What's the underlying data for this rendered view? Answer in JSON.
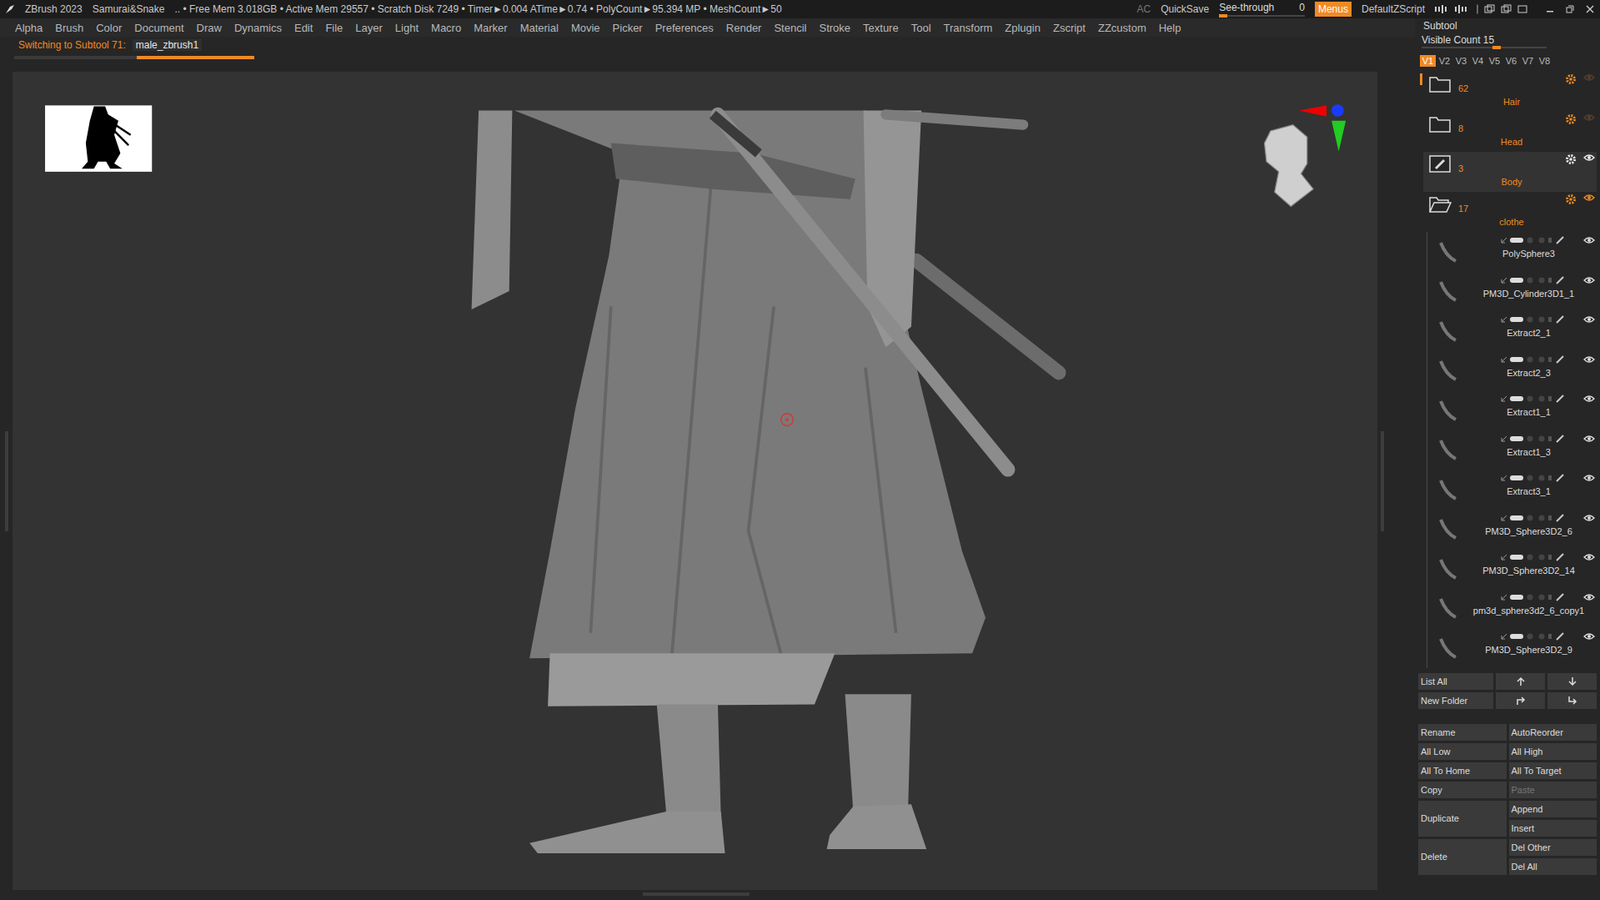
{
  "title_bar": {
    "app": "ZBrush 2023",
    "document": "Samurai&Snake",
    "stats": ".. • Free Mem 3.018GB • Active Mem 29557 • Scratch Disk 7249 • Timer►0.004 ATime►0.74 • PolyCount►95.394 MP • MeshCount►50",
    "ac": "AC",
    "quicksave": "QuickSave",
    "see_through": {
      "label": "See-through",
      "value": "0",
      "level": 0
    },
    "menus": {
      "label": "Menus",
      "selected": true
    },
    "script": "DefaultZScript"
  },
  "menu_bar": [
    "Alpha",
    "Brush",
    "Color",
    "Document",
    "Draw",
    "Dynamics",
    "Edit",
    "File",
    "Layer",
    "Light",
    "Macro",
    "Marker",
    "Material",
    "Movie",
    "Picker",
    "Preferences",
    "Render",
    "Stencil",
    "Stroke",
    "Texture",
    "Tool",
    "Transform",
    "Zplugin",
    "Zscript",
    "ZZcustom",
    "Help"
  ],
  "notice": {
    "label": "Switching to Subtool 71:",
    "subtool": "male_zbrush1",
    "level": 0.49
  },
  "subtool": {
    "title": "Subtool",
    "visible_count": {
      "label": "Visible Count 15",
      "level": 0.6
    },
    "views": [
      {
        "label": "V1",
        "selected": true
      },
      {
        "label": "V2",
        "selected": false
      },
      {
        "label": "V3",
        "selected": false
      },
      {
        "label": "V4",
        "selected": false
      },
      {
        "label": "V5",
        "selected": false
      },
      {
        "label": "V6",
        "selected": false
      },
      {
        "label": "V7",
        "selected": false
      },
      {
        "label": "V8",
        "selected": false
      }
    ],
    "folders": [
      {
        "count": "62",
        "name": "Hair",
        "selected": false,
        "expanded": false,
        "visible": false
      },
      {
        "count": "8",
        "name": "Head",
        "selected": false,
        "expanded": false,
        "visible": false
      },
      {
        "count": "3",
        "name": "Body",
        "selected": true,
        "expanded": false,
        "visible": true
      },
      {
        "count": "17",
        "name": "clothe",
        "selected": false,
        "expanded": true,
        "visible": true
      }
    ],
    "items": [
      {
        "name": "PolySphere3",
        "visible": true
      },
      {
        "name": "PM3D_Cylinder3D1_1",
        "visible": true
      },
      {
        "name": "Extract2_1",
        "visible": true
      },
      {
        "name": "Extract2_3",
        "visible": true
      },
      {
        "name": "Extract1_1",
        "visible": true
      },
      {
        "name": "Extract1_3",
        "visible": true
      },
      {
        "name": "Extract3_1",
        "visible": true
      },
      {
        "name": "PM3D_Sphere3D2_6",
        "visible": true
      },
      {
        "name": "PM3D_Sphere3D2_14",
        "visible": true
      },
      {
        "name": "pm3d_sphere3d2_6_copy1",
        "visible": true
      },
      {
        "name": "PM3D_Sphere3D2_9",
        "visible": true
      }
    ],
    "list_all": "List All",
    "new_folder": "New Folder",
    "buttons": [
      {
        "label": "Rename",
        "disabled": false,
        "kind": "normal"
      },
      {
        "label": "AutoReorder",
        "disabled": false,
        "kind": "normal"
      },
      {
        "label": "All Low",
        "disabled": false,
        "kind": "normal"
      },
      {
        "label": "All High",
        "disabled": false,
        "kind": "normal"
      },
      {
        "label": "All To Home",
        "disabled": false,
        "kind": "normal"
      },
      {
        "label": "All To Target",
        "disabled": false,
        "kind": "normal"
      },
      {
        "label": "Copy",
        "disabled": false,
        "kind": "normal"
      },
      {
        "label": "Paste",
        "disabled": true,
        "kind": "normal"
      },
      {
        "label": "Duplicate",
        "disabled": false,
        "kind": "tall"
      },
      {
        "label": "Append",
        "disabled": false,
        "kind": "normal"
      },
      {
        "label": "Insert",
        "disabled": false,
        "kind": "normal"
      },
      {
        "label": "Delete",
        "disabled": false,
        "kind": "tall"
      },
      {
        "label": "Del Other",
        "disabled": false,
        "kind": "normal"
      },
      {
        "label": "Del All",
        "disabled": false,
        "kind": "normal"
      }
    ]
  }
}
